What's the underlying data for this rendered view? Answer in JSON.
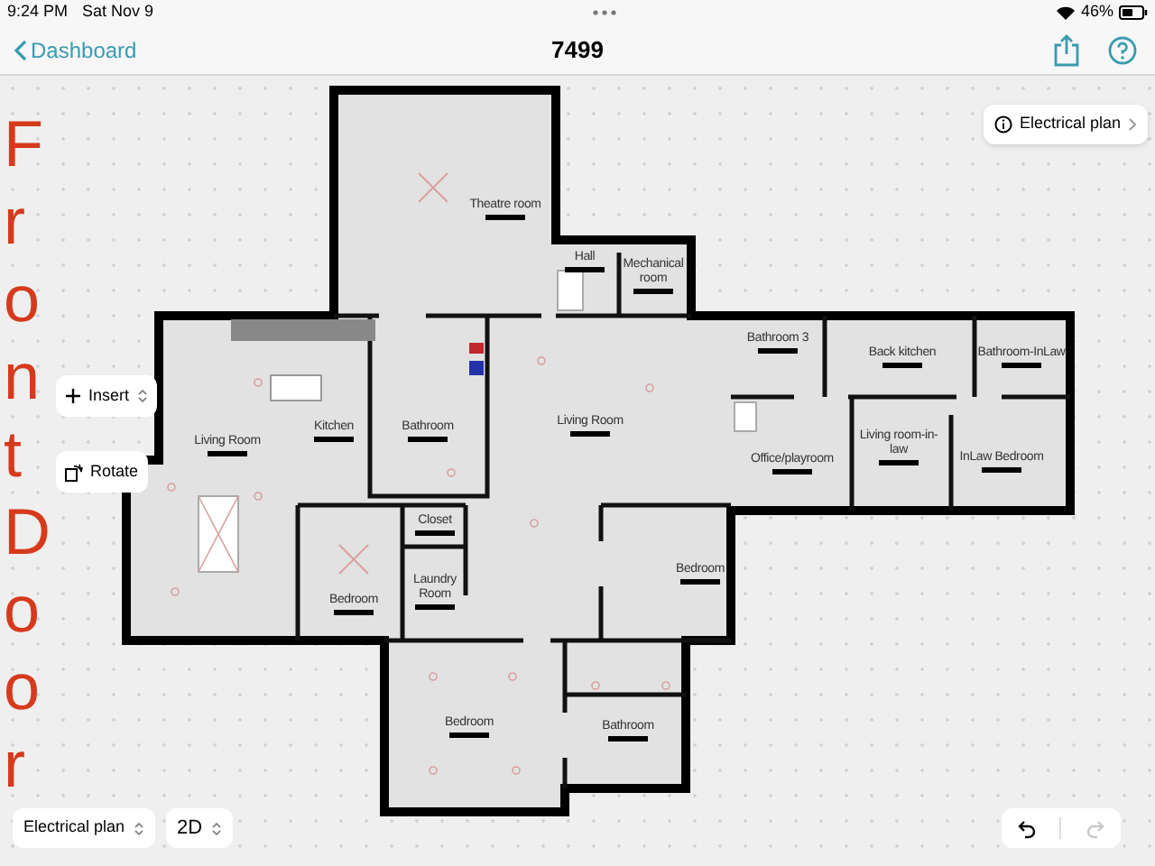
{
  "status_bar": {
    "time": "9:24 PM",
    "date": "Sat Nov 9",
    "battery": "46%"
  },
  "nav": {
    "back": "Dashboard",
    "title": "7499"
  },
  "plan_button": {
    "label": "Electrical plan"
  },
  "tools": [
    {
      "label": "Insert",
      "kind": "insert"
    },
    {
      "label": "Rotate",
      "kind": "rotate"
    }
  ],
  "rooms": [
    {
      "name": "Theatre room"
    },
    {
      "name": "Hall"
    },
    {
      "name": "Mechanical room"
    },
    {
      "name": "Bathroom 3"
    },
    {
      "name": "Back kitchen"
    },
    {
      "name": "Bathroom-InLaw"
    },
    {
      "name": "Living Room"
    },
    {
      "name": "Kitchen"
    },
    {
      "name": "Bathroom"
    },
    {
      "name": "Living Room"
    },
    {
      "name": "Living room-in-law"
    },
    {
      "name": "Office/playroom"
    },
    {
      "name": "InLaw Bedroom"
    },
    {
      "name": "Closet"
    },
    {
      "name": "Laundry Room"
    },
    {
      "name": "Bedroom"
    },
    {
      "name": "Bedroom"
    },
    {
      "name": "Bedroom"
    },
    {
      "name": "Bathroom"
    }
  ],
  "annotation": {
    "text": "Front Door"
  },
  "bottom": {
    "plan_select": "Electrical plan",
    "view_select": "2D"
  },
  "history": [
    {
      "kind": "undo",
      "disabled": false
    },
    {
      "kind": "redo",
      "disabled": true
    }
  ]
}
